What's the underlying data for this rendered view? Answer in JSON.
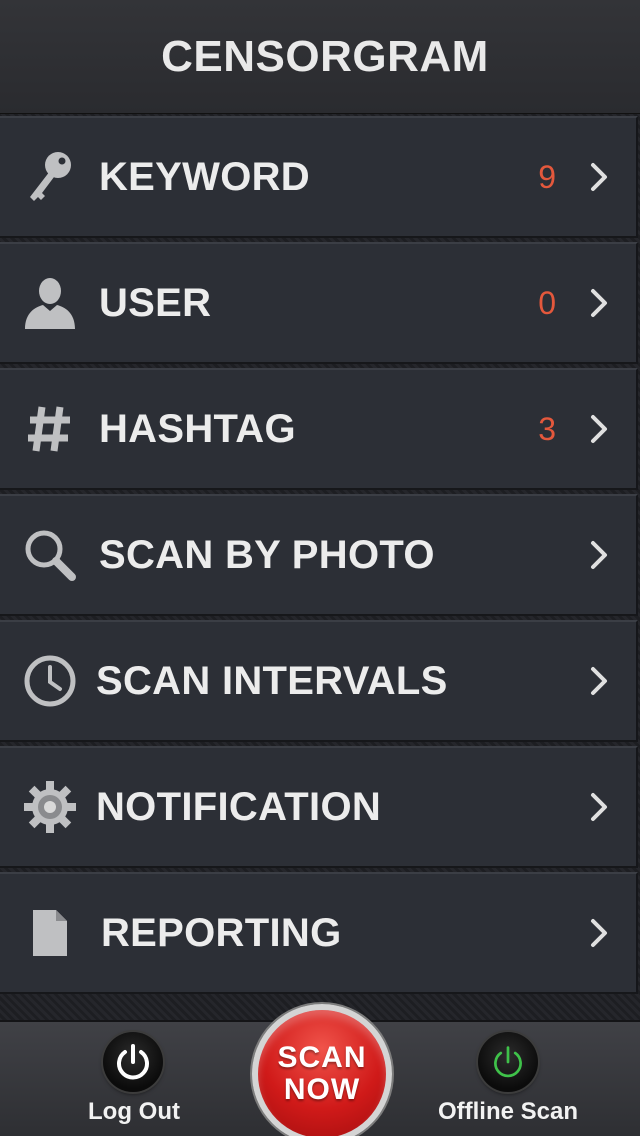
{
  "header": {
    "title": "CENSORGRAM"
  },
  "menu": {
    "items": [
      {
        "label": "KEYWORD",
        "count": "9",
        "icon": "key-icon"
      },
      {
        "label": "USER",
        "count": "0",
        "icon": "user-icon"
      },
      {
        "label": "HASHTAG",
        "count": "3",
        "icon": "hashtag-icon"
      },
      {
        "label": "SCAN BY PHOTO",
        "count": "",
        "icon": "search-icon"
      },
      {
        "label": "SCAN INTERVALS",
        "count": "",
        "icon": "clock-icon"
      },
      {
        "label": "NOTIFICATION",
        "count": "",
        "icon": "gear-icon"
      },
      {
        "label": "REPORTING",
        "count": "",
        "icon": "document-icon"
      }
    ]
  },
  "bottom": {
    "logout_label": "Log Out",
    "scan_now_line1": "SCAN",
    "scan_now_line2": "NOW",
    "offline_label": "Offline Scan"
  },
  "colors": {
    "accent_count": "#e4583c",
    "scan_button": "#d01a19",
    "offline_power": "#3fc24a"
  }
}
